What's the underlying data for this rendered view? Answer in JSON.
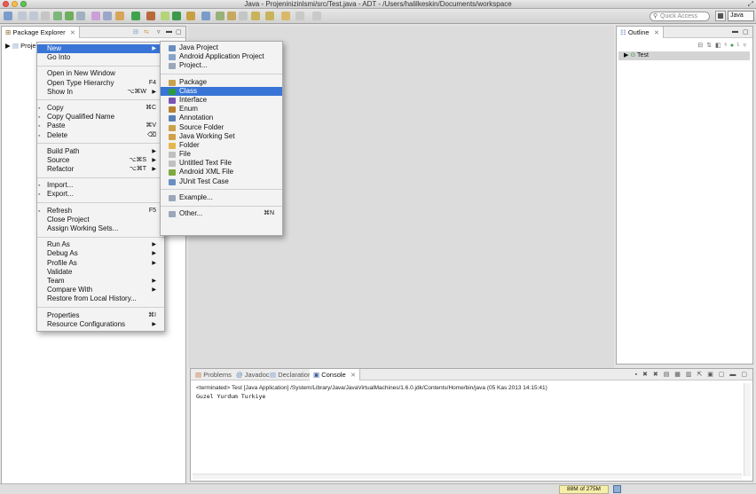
{
  "window": {
    "title": "Java - Projeninizinlsmi/src/Test.java - ADT - /Users/halilkeskin/Documents/workspace"
  },
  "toolbar": {
    "quick_access_placeholder": "Quick Access",
    "perspective_label": "Java"
  },
  "package_explorer": {
    "tab_label": "Package Explorer",
    "close_glyph": "⨯",
    "project_label": "Projen"
  },
  "outline": {
    "tab_label": "Outline",
    "close_glyph": "⨯",
    "tree_item": "Test"
  },
  "console": {
    "tabs": [
      {
        "label": "Problems"
      },
      {
        "label": "Javadoc"
      },
      {
        "label": "Declaration"
      },
      {
        "label": "Console"
      }
    ],
    "close_glyph": "⨯",
    "terminated_line": "<terminated> Test [Java Application] /System/Library/Java/JavaVirtualMachines/1.6.0.jdk/Contents/Home/bin/java (05 Kas 2013 14:15:41)",
    "output": "Guzel Yurdum Turkiye"
  },
  "status": {
    "memory": "88M of 275M"
  },
  "context_menu": {
    "groups": [
      [
        {
          "label": "New",
          "arrow": "▶",
          "selected": true
        },
        {
          "label": "Go Into"
        }
      ],
      [
        {
          "label": "Open in New Window"
        },
        {
          "label": "Open Type Hierarchy",
          "shortcut": "F4"
        },
        {
          "label": "Show In",
          "shortcut": "⌥⌘W",
          "arrow": "▶"
        }
      ],
      [
        {
          "label": "Copy",
          "shortcut": "⌘C",
          "icon": "copy-icon"
        },
        {
          "label": "Copy Qualified Name",
          "icon": "copy-qualified-name-icon"
        },
        {
          "label": "Paste",
          "shortcut": "⌘V",
          "icon": "paste-icon"
        },
        {
          "label": "Delete",
          "shortcut": "⌫",
          "icon": "delete-icon"
        }
      ],
      [
        {
          "label": "Build Path",
          "arrow": "▶"
        },
        {
          "label": "Source",
          "shortcut": "⌥⌘S",
          "arrow": "▶"
        },
        {
          "label": "Refactor",
          "shortcut": "⌥⌘T",
          "arrow": "▶"
        }
      ],
      [
        {
          "label": "Import...",
          "icon": "import-icon"
        },
        {
          "label": "Export...",
          "icon": "export-icon"
        }
      ],
      [
        {
          "label": "Refresh",
          "shortcut": "F5",
          "icon": "refresh-icon"
        },
        {
          "label": "Close Project"
        },
        {
          "label": "Assign Working Sets..."
        }
      ],
      [
        {
          "label": "Run As",
          "arrow": "▶"
        },
        {
          "label": "Debug As",
          "arrow": "▶"
        },
        {
          "label": "Profile As",
          "arrow": "▶"
        },
        {
          "label": "Validate"
        },
        {
          "label": "Team",
          "arrow": "▶"
        },
        {
          "label": "Compare With",
          "arrow": "▶"
        },
        {
          "label": "Restore from Local History..."
        }
      ],
      [
        {
          "label": "Properties",
          "shortcut": "⌘I"
        },
        {
          "label": "Resource Configurations",
          "arrow": "▶"
        }
      ]
    ]
  },
  "new_submenu": {
    "groups": [
      [
        {
          "label": "Java Project",
          "icon": "java-project-icon",
          "color": "#6a8fbf"
        },
        {
          "label": "Android Application Project",
          "icon": "android-project-icon",
          "color": "#8aa4c8"
        },
        {
          "label": "Project...",
          "icon": "project-icon",
          "color": "#9aa8b8"
        }
      ],
      [
        {
          "label": "Package",
          "icon": "package-icon",
          "color": "#c9a24b"
        },
        {
          "label": "Class",
          "icon": "class-icon",
          "color": "#2e9a3e",
          "selected": true
        },
        {
          "label": "Interface",
          "icon": "interface-icon",
          "color": "#7a55b5"
        },
        {
          "label": "Enum",
          "icon": "enum-icon",
          "color": "#b7812e"
        },
        {
          "label": "Annotation",
          "icon": "annotation-icon",
          "color": "#5a7fb5"
        },
        {
          "label": "Source Folder",
          "icon": "source-folder-icon",
          "color": "#c9a24b"
        },
        {
          "label": "Java Working Set",
          "icon": "java-working-set-icon",
          "color": "#d0a04a"
        },
        {
          "label": "Folder",
          "icon": "folder-icon",
          "color": "#e2b84e"
        },
        {
          "label": "File",
          "icon": "file-icon",
          "color": "#c0c0c0"
        },
        {
          "label": "Untitled Text File",
          "icon": "text-file-icon",
          "color": "#c0c0c0"
        },
        {
          "label": "Android XML File",
          "icon": "android-xml-icon",
          "color": "#7eaa3e"
        },
        {
          "label": "JUnit Test Case",
          "icon": "junit-icon",
          "color": "#6a8fbf"
        }
      ],
      [
        {
          "label": "Example...",
          "icon": "example-icon",
          "color": "#9aa8b8"
        }
      ],
      [
        {
          "label": "Other...",
          "shortcut": "⌘N",
          "icon": "other-icon",
          "color": "#9aa8b8"
        }
      ]
    ]
  }
}
